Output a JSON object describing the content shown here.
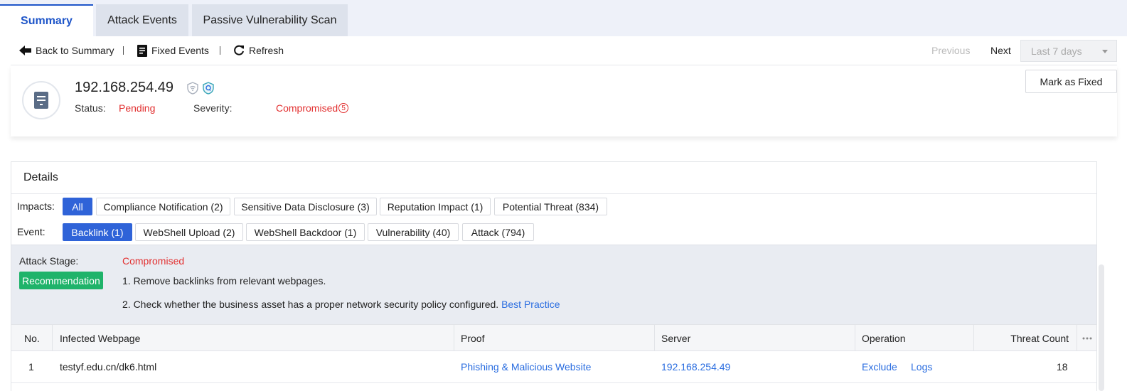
{
  "tabs": [
    {
      "label": "Summary",
      "active": true
    },
    {
      "label": "Attack Events",
      "active": false
    },
    {
      "label": "Passive Vulnerability Scan",
      "active": false
    }
  ],
  "toolbar": {
    "back_label": "Back to Summary",
    "fixed_label": "Fixed Events",
    "refresh_label": "Refresh",
    "previous_label": "Previous",
    "next_label": "Next",
    "range_value": "Last 7 days"
  },
  "asset": {
    "ip": "192.168.254.49",
    "status_label": "Status:",
    "status_value": "Pending",
    "severity_label": "Severity:",
    "severity_value": "Compromised",
    "severity_level": "5",
    "mark_fixed_label": "Mark as Fixed"
  },
  "details": {
    "title": "Details",
    "impacts_label": "Impacts:",
    "impacts": [
      "All",
      "Compliance Notification (2)",
      "Sensitive Data Disclosure (3)",
      "Reputation Impact (1)",
      "Potential Threat (834)"
    ],
    "event_label": "Event:",
    "events": [
      "Backlink (1)",
      "WebShell Upload (2)",
      "WebShell Backdoor (1)",
      "Vulnerability (40)",
      "Attack (794)"
    ],
    "stage_label": "Attack Stage:",
    "stage_value": "Compromised",
    "recommendation_label": "Recommendation",
    "rec_1": "1. Remove backlinks from relevant webpages.",
    "rec_2": "2. Check whether the business asset has a proper network security policy configured.",
    "best_practice_label": "Best Practice"
  },
  "table": {
    "headers": [
      "No.",
      "Infected Webpage",
      "Proof",
      "Server",
      "Operation",
      "Threat Count"
    ],
    "rows": [
      {
        "no": "1",
        "webpage": "testyf.edu.cn/dk6.html",
        "proof": "Phishing & Malicious Website",
        "server": "192.168.254.49",
        "exclude": "Exclude",
        "logs": "Logs",
        "threat_count": "18"
      }
    ]
  },
  "colors": {
    "accent": "#1f56c9",
    "chip_active": "#2f63d8",
    "danger": "#e23030",
    "link": "#2a6de0",
    "recommend": "#1fb36a"
  }
}
